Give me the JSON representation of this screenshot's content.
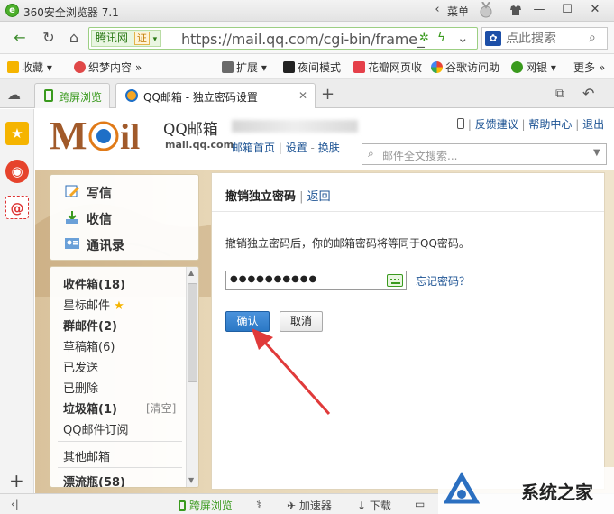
{
  "browser": {
    "title": "360安全浏览器 7.1",
    "menu_label": "菜单",
    "site_badge": "腾讯网",
    "cert_badge": "证",
    "url": "https://mail.qq.com/cgi-bin/frame_",
    "search_placeholder": "点此搜索"
  },
  "bookmarks": [
    {
      "label": "收藏"
    },
    {
      "label": "织梦内容"
    },
    {
      "label": "扩展"
    },
    {
      "label": "夜间模式"
    },
    {
      "label": "花瓣网页收"
    },
    {
      "label": "谷歌访问助"
    },
    {
      "label": "网银"
    },
    {
      "label": "更多"
    }
  ],
  "tabs": [
    {
      "label": "跨屏浏览"
    },
    {
      "label": "QQ邮箱 - 独立密码设置"
    }
  ],
  "mail_header": {
    "logo_text": "MOil",
    "brand": "QQ邮箱",
    "domain": "mail.qq.com",
    "links": [
      "邮箱首页",
      "设置",
      "换肤"
    ],
    "top_links": [
      "反馈建议",
      "帮助中心",
      "退出"
    ],
    "search_placeholder": "邮件全文搜索..."
  },
  "quick_actions": [
    {
      "label": "写信"
    },
    {
      "label": "收信"
    },
    {
      "label": "通讯录"
    }
  ],
  "folders": [
    {
      "label": "收件箱(18)",
      "bold": true
    },
    {
      "label": "星标邮件",
      "bold": false
    },
    {
      "label": "群邮件(2)",
      "bold": true
    },
    {
      "label": "草稿箱(6)",
      "bold": false
    },
    {
      "label": "已发送",
      "bold": false
    },
    {
      "label": "已删除",
      "bold": false
    },
    {
      "label": "垃圾箱(1)",
      "bold": true
    },
    {
      "label": "QQ邮件订阅",
      "bold": false
    }
  ],
  "trash_clear": "[清空]",
  "other_mailbox": "其他邮箱",
  "partial_folder": "漂流瓶(58)",
  "content": {
    "title": "撤销独立密码",
    "back_link": "返回",
    "description": "撤销独立密码后，你的邮箱密码将等同于QQ密码。",
    "password_value": "●●●●●●●●●●",
    "forgot_link": "忘记密码？",
    "confirm_button": "确认",
    "cancel_button": "取消"
  },
  "statusbar": {
    "cross_screen": "跨屏浏览",
    "accelerator": "加速器",
    "download": "下载"
  },
  "watermark": "系统之家",
  "colors": {
    "browser_green": "#3a9a1e",
    "confirm_blue": "#2b78c5",
    "arrow_red": "#e03a3a",
    "link_blue": "#1e5494"
  }
}
